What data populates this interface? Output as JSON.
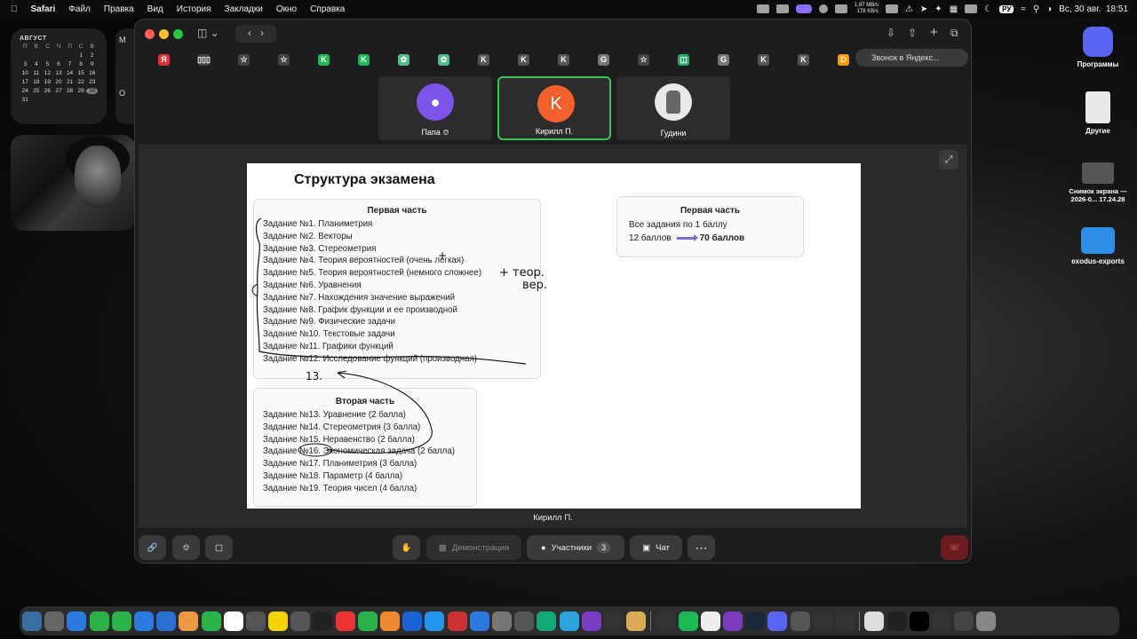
{
  "menubar": {
    "app": "Safari",
    "items": [
      "Файл",
      "Правка",
      "Вид",
      "История",
      "Закладки",
      "Окно",
      "Справка"
    ],
    "net_up": "1,87 MB/s",
    "net_down": "178 KB/s",
    "lang": "РУ",
    "datetime": "Вс, 30 авг.  18:51"
  },
  "calendar": {
    "month": "АВГУСТ",
    "days": [
      "П",
      "В",
      "С",
      "Ч",
      "П",
      "С",
      "В"
    ],
    "dates": [
      "",
      "",
      "",
      "",
      "",
      "1",
      "2",
      "3",
      "4",
      "5",
      "6",
      "7",
      "8",
      "9",
      "10",
      "11",
      "12",
      "13",
      "14",
      "15",
      "16",
      "17",
      "18",
      "19",
      "20",
      "21",
      "22",
      "23",
      "24",
      "25",
      "26",
      "27",
      "28",
      "29",
      "30",
      "31",
      "",
      "",
      "",
      "",
      "",
      ""
    ],
    "today": "30",
    "side_letter": "M",
    "side_o": "O"
  },
  "desktop": [
    {
      "label": "Программы"
    },
    {
      "label": "Другие"
    },
    {
      "label": "Снимок экрана — 2026-0... 17.24.28"
    },
    {
      "label": "exodus-exports"
    }
  ],
  "browser": {
    "url_text": "Звонок в Яндекс...",
    "bookmarks": [
      "Я",
      "▯▯▯",
      "☆",
      "☆",
      "K",
      "K",
      "✿",
      "✿",
      "K",
      "K",
      "K",
      "G",
      "☆",
      "◫",
      "G",
      "K",
      "K",
      "D"
    ]
  },
  "participants": [
    {
      "name": "Папа",
      "initial": "",
      "muted": true
    },
    {
      "name": "Кирилл П.",
      "initial": "K",
      "speaking": true
    },
    {
      "name": "Гудини",
      "initial": ""
    }
  ],
  "slide": {
    "title": "Структура экзамена",
    "part1": {
      "title": "Первая часть",
      "items": [
        "Задание №1. Планиметрия",
        "Задание №2. Векторы",
        "Задание №3. Стереометрия",
        "Задание №4. Теория вероятностей (очень легкая)",
        "Задание №5. Теория вероятностей (немного сложнее)",
        "Задание №6. Уравнения",
        "Задание №7. Нахождения значение выражений",
        "Задание №8. График функции и ее производной",
        "Задание №9. Физические задачи",
        "Задание №10. Текстовые задачи",
        "Задание №11. Графики функций",
        "Задание №12. Исследование функций (производная)"
      ]
    },
    "part2": {
      "title": "Вторая часть",
      "items": [
        "Задание №13. Уравнение (2 балла)",
        "Задание №14. Стереометрия (3 балла)",
        "Задание №15. Неравенство (2 балла)",
        "Задание №16. Экономическая задача (2 балла)",
        "Задание №17. Планиметрия (3 балла)",
        "Задание №18. Параметр (4 балла)",
        "Задание №19. Теория чисел (4 балла)"
      ]
    },
    "summary": {
      "title": "Первая часть",
      "line1": "Все задания по 1 баллу",
      "line2_left": "12 баллов",
      "line2_right": "70 баллов"
    },
    "ink_1": "+ теор.",
    "ink_2": "вер.",
    "ink_3": "13.",
    "ink_4": "+"
  },
  "stage": {
    "caption": "Кирилл П."
  },
  "controls": {
    "demo": "Демонстрация",
    "participants": "Участники",
    "participants_count": "3",
    "chat": "Чат"
  },
  "colors": {
    "accent_green": "#35c759",
    "end_call": "#6b1d1d",
    "avatar_purple": "#7b55e8",
    "avatar_orange": "#f2612d"
  }
}
